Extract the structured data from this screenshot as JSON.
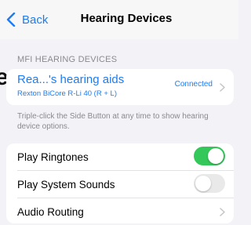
{
  "nav": {
    "back_label": "Back",
    "title": "Hearing Devices"
  },
  "left_clip_text": "e",
  "section": {
    "header": "MFI HEARING DEVICES"
  },
  "device": {
    "name": "Rea...'s hearing aids",
    "model": "Rexton BiCore R-Li 40 (R + L)",
    "status": "Connected"
  },
  "footnote": "Triple-click the Side Button at any time to show hearing device options.",
  "settings": [
    {
      "label": "Play Ringtones",
      "type": "toggle",
      "on": true
    },
    {
      "label": "Play System Sounds",
      "type": "toggle",
      "on": false
    },
    {
      "label": "Audio Routing",
      "type": "link"
    }
  ],
  "colors": {
    "accent": "#1e7cf2",
    "toggle_on": "#34c759",
    "toggle_off": "#e9e9ea"
  }
}
